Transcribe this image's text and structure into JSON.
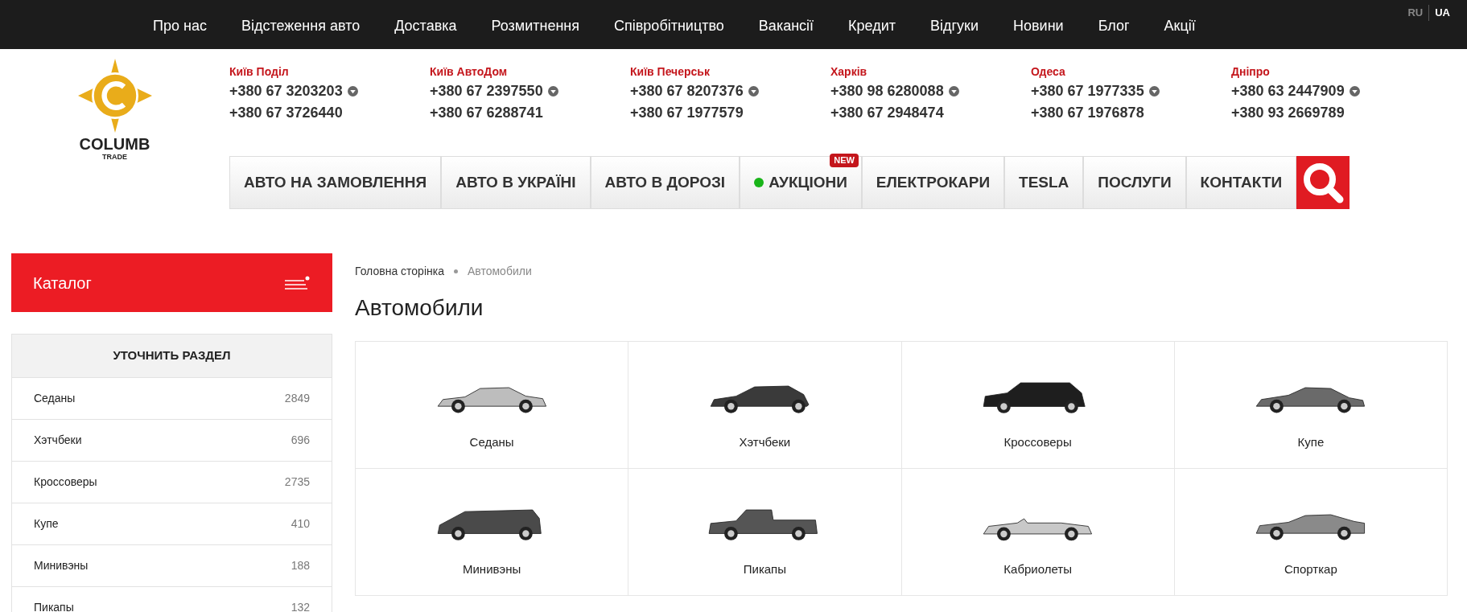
{
  "top_menu": [
    "Про нас",
    "Відстеження авто",
    "Доставка",
    "Розмитнення",
    "Співробітництво",
    "Вакансії",
    "Кредит",
    "Відгуки",
    "Новини",
    "Блог",
    "Акції"
  ],
  "languages": [
    {
      "label": "RU",
      "selected": false
    },
    {
      "label": "UA",
      "selected": true
    }
  ],
  "logo": {
    "name": "COLUMB",
    "sub": "TRADE"
  },
  "contacts": [
    {
      "city": "Київ Поділ",
      "phones": [
        "+380 67 3203203",
        "+380 67 3726440"
      ]
    },
    {
      "city": "Київ АвтоДом",
      "phones": [
        "+380 67 2397550",
        "+380 67 6288741"
      ]
    },
    {
      "city": "Київ Печерськ",
      "phones": [
        "+380 67 8207376",
        "+380 67 1977579"
      ]
    },
    {
      "city": "Харків",
      "phones": [
        "+380 98 6280088",
        "+380 67 2948474"
      ]
    },
    {
      "city": "Одеса",
      "phones": [
        "+380 67 1977335",
        "+380 67 1976878"
      ]
    },
    {
      "city": "Дніпро",
      "phones": [
        "+380 63 2447909",
        "+380 93 2669789"
      ]
    }
  ],
  "main_nav": [
    {
      "label": "АВТО НА ЗАМОВЛЕННЯ"
    },
    {
      "label": "АВТО В УКРАЇНІ"
    },
    {
      "label": "АВТО В ДОРОЗІ"
    },
    {
      "label": "АУКЦІОНИ",
      "live": true,
      "badge": "NEW"
    },
    {
      "label": "ЕЛЕКТРОКАРИ"
    },
    {
      "label": "TESLA"
    },
    {
      "label": "ПОСЛУГИ"
    },
    {
      "label": "КОНТАКТИ"
    }
  ],
  "catalog": {
    "title": "Каталог"
  },
  "refine": {
    "title": "УТОЧНИТЬ РАЗДЕЛ",
    "items": [
      {
        "name": "Седаны",
        "count": "2849"
      },
      {
        "name": "Хэтчбеки",
        "count": "696"
      },
      {
        "name": "Кроссоверы",
        "count": "2735"
      },
      {
        "name": "Купе",
        "count": "410"
      },
      {
        "name": "Минивэны",
        "count": "188"
      },
      {
        "name": "Пикапы",
        "count": "132"
      }
    ]
  },
  "breadcrumbs": [
    "Головна сторінка",
    "Автомобили"
  ],
  "page_title": "Автомобили",
  "categories": [
    {
      "label": "Седаны",
      "kind": "sedan",
      "color": "#bdbdbd"
    },
    {
      "label": "Хэтчбеки",
      "kind": "hatchback",
      "color": "#3a3a3a"
    },
    {
      "label": "Кроссоверы",
      "kind": "suv",
      "color": "#1e1e1e"
    },
    {
      "label": "Купе",
      "kind": "coupe",
      "color": "#6a6a6a"
    },
    {
      "label": "Минивэны",
      "kind": "van",
      "color": "#4a4a4a"
    },
    {
      "label": "Пикапы",
      "kind": "pickup",
      "color": "#555555"
    },
    {
      "label": "Кабриолеты",
      "kind": "convertible",
      "color": "#c8c8c8"
    },
    {
      "label": "Спорткар",
      "kind": "sport",
      "color": "#8a8a8a"
    }
  ]
}
